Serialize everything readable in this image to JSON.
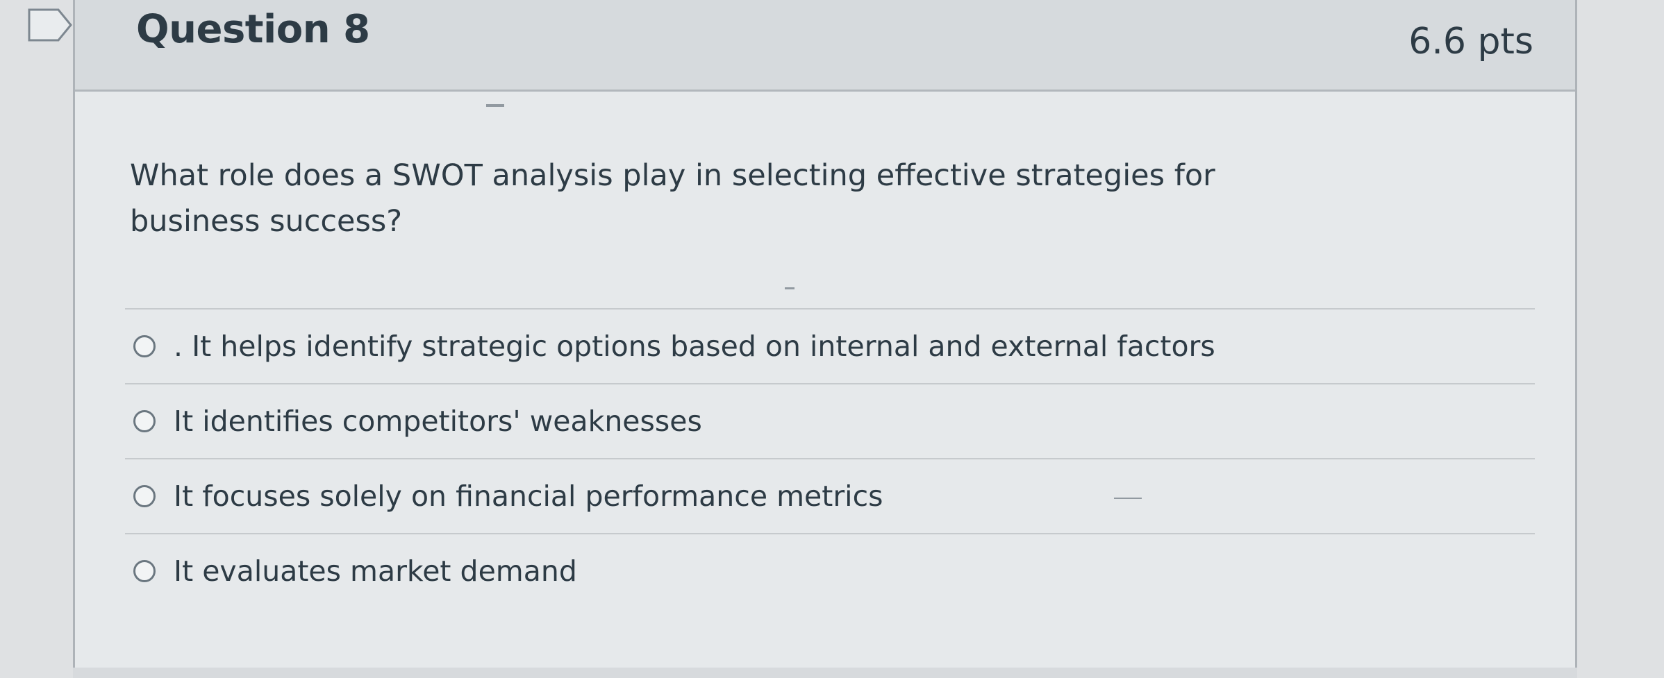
{
  "question": {
    "title": "Question 8",
    "points": "6.6 pts",
    "text": "What role does a SWOT analysis play in selecting effective strategies for business success?"
  },
  "answers": [
    {
      "label": ". It helps identify strategic options based on internal and external factors"
    },
    {
      "label": "It identifies competitors' weaknesses"
    },
    {
      "label": "It focuses solely on financial performance metrics"
    },
    {
      "label": "It evaluates market demand"
    }
  ],
  "icons": {
    "flag": "flag-bookmark-icon",
    "radio": "radio-unselected-icon"
  },
  "colors": {
    "text": "#2d3b45",
    "border": "#aeb3b8",
    "header_bg": "#d6dadd",
    "body_bg": "#e6e9eb"
  }
}
